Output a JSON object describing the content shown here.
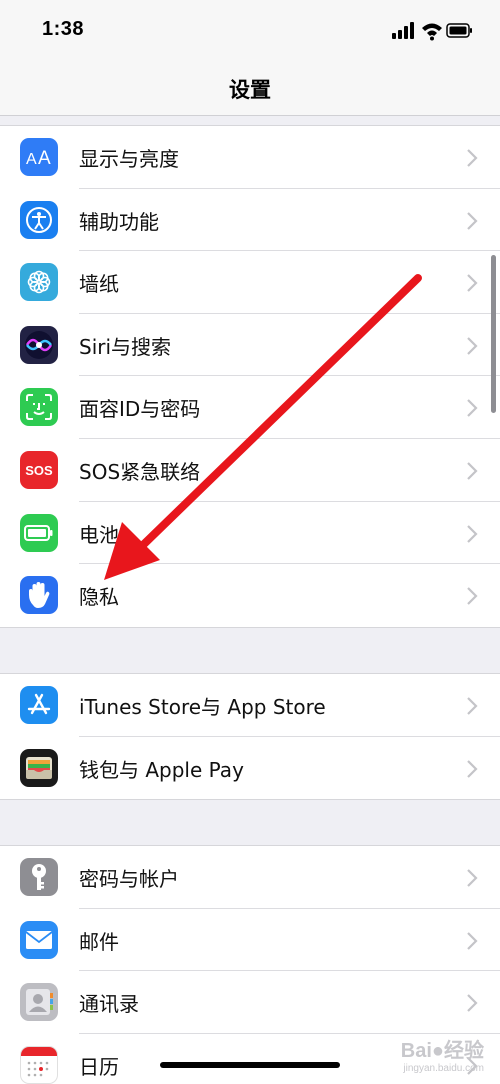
{
  "status": {
    "time": "1:38"
  },
  "nav": {
    "title": "设置"
  },
  "group1": [
    {
      "label": "显示与亮度",
      "icon": "display-brightness-icon",
      "color": "#2f7cf6"
    },
    {
      "label": "辅助功能",
      "icon": "accessibility-icon",
      "color": "#1a7ff0"
    },
    {
      "label": "墙纸",
      "icon": "wallpaper-icon",
      "color": "#35aadc"
    },
    {
      "label": "Siri与搜索",
      "icon": "siri-icon",
      "color": "#222244"
    },
    {
      "label": "面容ID与密码",
      "icon": "face-id-icon",
      "color": "#2ecb52"
    },
    {
      "label": "SOS紧急联络",
      "icon": "sos-icon",
      "color": "#e8262b"
    },
    {
      "label": "电池",
      "icon": "battery-icon",
      "color": "#2ecb52"
    },
    {
      "label": "隐私",
      "icon": "privacy-hand-icon",
      "color": "#2a6ff0"
    }
  ],
  "group2": [
    {
      "label": "iTunes Store与 App Store",
      "icon": "app-store-icon",
      "color": "#1e8ef0"
    },
    {
      "label": "钱包与 Apple Pay",
      "icon": "wallet-icon",
      "color": "#1a1a1a"
    }
  ],
  "group3": [
    {
      "label": "密码与帐户",
      "icon": "key-icon",
      "color": "#8e8e93"
    },
    {
      "label": "邮件",
      "icon": "mail-icon",
      "color": "#2b8df5"
    },
    {
      "label": "通讯录",
      "icon": "contacts-icon",
      "color": "#bdbdc2"
    },
    {
      "label": "日历",
      "icon": "calendar-icon",
      "color": "#ffffff"
    }
  ],
  "annotation": {
    "arrow_color": "#e8161c"
  },
  "watermark": {
    "brand": "Bai",
    "brand_tail": "经验",
    "url": "jingyan.baidu.com"
  }
}
